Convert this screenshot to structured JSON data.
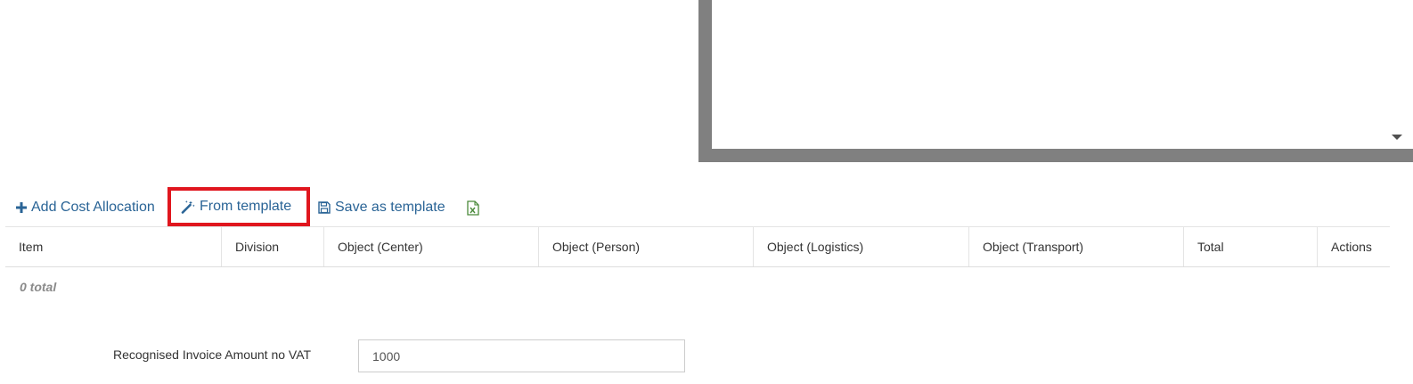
{
  "toolbar": {
    "add_label": "Add Cost Allocation",
    "from_template_label": "From template",
    "save_template_label": "Save as template",
    "add_icon": "plus-icon",
    "from_template_icon": "magic-wand-icon",
    "save_template_icon": "floppy-disk-icon",
    "excel_icon": "excel-export-icon",
    "link_color": "#2a6496",
    "highlight_color": "#e0161e"
  },
  "table": {
    "columns": [
      "Item",
      "Division",
      "Object (Center)",
      "Object (Person)",
      "Object (Logistics)",
      "Object (Transport)",
      "Total",
      "Actions"
    ],
    "rows": [],
    "total_note": "0 total"
  },
  "form": {
    "amount_label": "Recognised Invoice Amount no VAT",
    "amount_value": "1000"
  }
}
